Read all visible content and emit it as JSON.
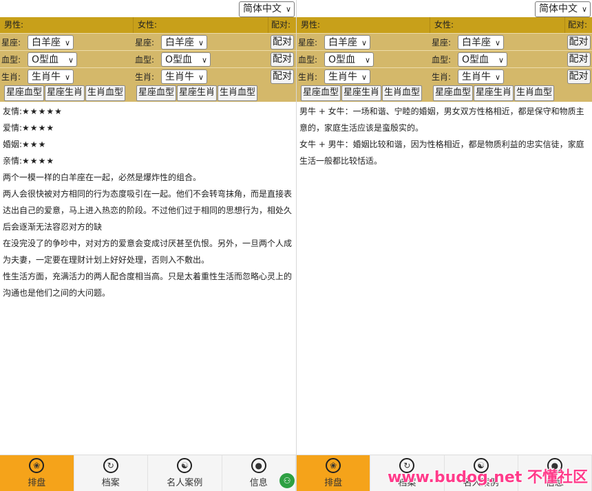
{
  "left": {
    "language": "简体中文",
    "header": {
      "male": "男性:",
      "female": "女性:",
      "pair": "配对:"
    },
    "rows": [
      {
        "label": "星座:",
        "value": "白羊座",
        "button": "配对"
      },
      {
        "label": "血型:",
        "value": "O型血",
        "button": "配对"
      },
      {
        "label": "生肖:",
        "value": "生肖牛",
        "button": "配对"
      }
    ],
    "group_buttons": [
      "星座血型",
      "星座生肖",
      "生肖血型"
    ],
    "ratings": [
      {
        "label": "友情:",
        "stars": "★★★★★"
      },
      {
        "label": "爱情:",
        "stars": "★★★★"
      },
      {
        "label": "婚姻:",
        "stars": "★★★"
      },
      {
        "label": "亲情:",
        "stars": "★★★★"
      }
    ],
    "paragraphs": [
      "两个一模一样的白羊座在一起，必然是爆炸性的组合。",
      "两人会很快被对方相同的行为态度吸引在一起。他们不会转弯抹角，而是直接表达出自己的爱意，马上进入热恋的阶段。不过他们过于相同的思想行为，相处久后会逐渐无法容忍对方的缺",
      "在没完没了的争吵中，对对方的爱意会变成讨厌甚至仇恨。另外，一旦两个人成为夫妻，一定要在理财计划上好好处理，否则入不敷出。",
      "性生活方面，充满活力的两人配合度相当高。只是太着重性生活而忽略心灵上的沟通也是他们之间的大问题。"
    ]
  },
  "right": {
    "language": "简体中文",
    "header": {
      "male": "男性:",
      "female": "女性:",
      "pair": "配对:"
    },
    "rows": [
      {
        "label": "星座:",
        "value": "白羊座",
        "button": "配对"
      },
      {
        "label": "血型:",
        "value": "O型血",
        "button": "配对"
      },
      {
        "label": "生肖:",
        "value": "生肖牛",
        "button": "配对"
      }
    ],
    "group_buttons": [
      "星座血型",
      "星座生肖",
      "生肖血型"
    ],
    "paragraphs": [
      "男牛 + 女牛：一场和谐、宁睦的婚姻，男女双方性格相近，都是保守和物质主意的，家庭生活应该是蛮殷实的。",
      "女牛 + 男牛：婚姻比较和谐，因为性格相近，都是物质利益的忠实信徒，家庭生活一般都比较恬适。"
    ]
  },
  "tabs": [
    "排盘",
    "档案",
    "名人案例",
    "信息"
  ],
  "tab_icons": [
    "flower-icon",
    "clock-icon",
    "yin-yang-icon",
    "user-icon"
  ],
  "watermark": "www.budog.net 不懂社区",
  "colors": {
    "accent": "#f5a31a",
    "header": "#c8a01a",
    "form_bg": "#d4b86a"
  }
}
